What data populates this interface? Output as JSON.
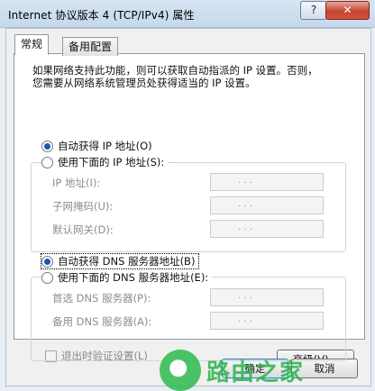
{
  "window": {
    "title": "Internet 协议版本 4 (TCP/IPv4) 属性",
    "help_label": "?",
    "close_label": "✕"
  },
  "tabs": [
    {
      "label": "常规",
      "active": true
    },
    {
      "label": "备用配置",
      "active": false
    }
  ],
  "description": {
    "line1": "如果网络支持此功能，则可以获取自动指派的 IP 设置。否则，",
    "line2": "您需要从网络系统管理员处获得适当的 IP 设置。"
  },
  "ip_section": {
    "auto_label": "自动获得 IP 地址(O)",
    "auto_selected": true,
    "manual_label": "使用下面的 IP 地址(S):",
    "manual_selected": false,
    "fields": [
      {
        "label": "IP 地址(I):",
        "value": ". . ."
      },
      {
        "label": "子网掩码(U):",
        "value": ". . ."
      },
      {
        "label": "默认网关(D):",
        "value": ". . ."
      }
    ]
  },
  "dns_section": {
    "auto_label": "自动获得 DNS 服务器地址(B)",
    "auto_selected": true,
    "manual_label": "使用下面的 DNS 服务器地址(E):",
    "manual_selected": false,
    "fields": [
      {
        "label": "首选 DNS 服务器(P):",
        "value": ". . ."
      },
      {
        "label": "备用 DNS 服务器(A):",
        "value": ". . ."
      }
    ]
  },
  "validate_checkbox": {
    "label": "退出时验证设置(L)",
    "checked": false
  },
  "buttons": {
    "advanced": "高级(V)...",
    "ok": "确定",
    "cancel": "取消"
  },
  "watermark": {
    "text": "路由之家"
  },
  "colors": {
    "accent": "#1e52b5",
    "watermark": "#2ab34d"
  }
}
